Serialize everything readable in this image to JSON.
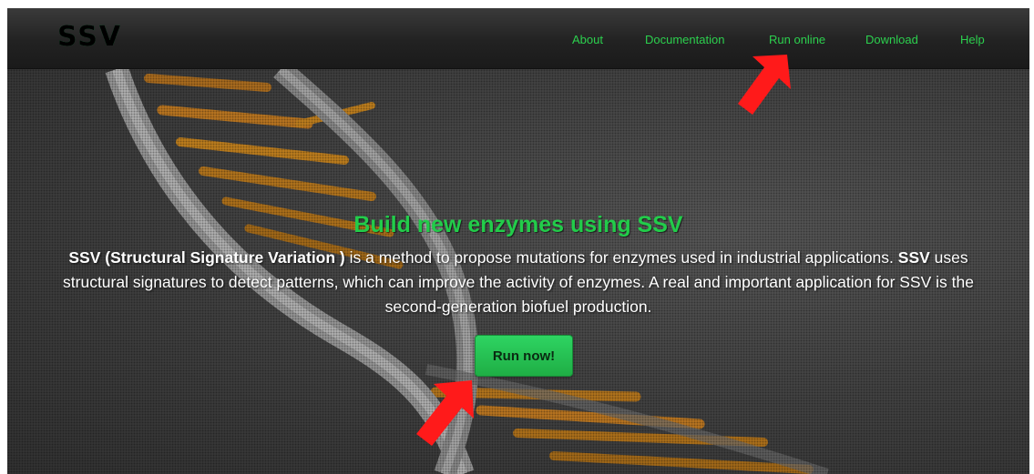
{
  "nav": {
    "logo": "SSV",
    "about": "About",
    "documentation": "Documentation",
    "run_online": "Run online",
    "download": "Download",
    "help": "Help"
  },
  "hero": {
    "title": "Build new enzymes using SSV",
    "desc_bold_1": "SSV (Structural Signature Variation )",
    "desc_text_1": " is a method to propose mutations for enzymes used in industrial applications. ",
    "desc_bold_2": "SSV",
    "desc_text_2": " uses structural signatures to detect patterns, which can improve the activity of enzymes. A real and important application for SSV is the second-generation biofuel production.",
    "button": "Run now!"
  },
  "colors": {
    "accent": "#2cd04e",
    "annotation_arrow": "#ff1a1a"
  },
  "icons": {
    "annotation": "red-arrow-icon"
  }
}
